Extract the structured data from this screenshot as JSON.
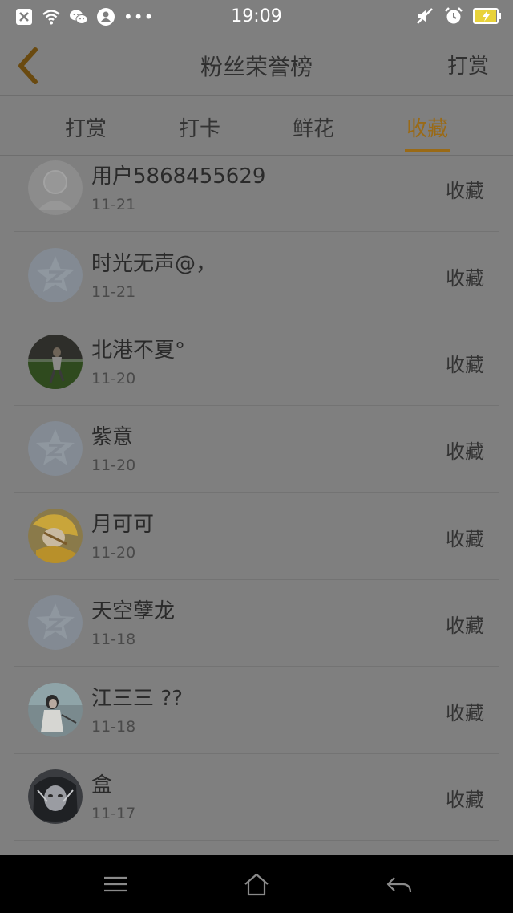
{
  "status_bar": {
    "time": "19:09",
    "dots": "•••",
    "left_icons": [
      "close-box-icon",
      "wifi-icon",
      "wechat-icon",
      "notification-icon"
    ],
    "right_icons": [
      "mute-icon",
      "alarm-icon",
      "battery-charging-icon"
    ]
  },
  "header": {
    "title": "粉丝荣誉榜",
    "action_label": "打赏",
    "accent_color": "#9a6a16"
  },
  "tabs": [
    {
      "label": "打赏",
      "active": false
    },
    {
      "label": "打卡",
      "active": false
    },
    {
      "label": "鲜花",
      "active": false
    },
    {
      "label": "收藏",
      "active": true
    }
  ],
  "list": [
    {
      "name": "用户5868455629",
      "date": "11-21",
      "action": "收藏",
      "avatar": "default-user"
    },
    {
      "name": "时光无声@，",
      "date": "11-21",
      "action": "收藏",
      "avatar": "qzone-star"
    },
    {
      "name": "北港不夏°",
      "date": "11-20",
      "action": "收藏",
      "avatar": "photo-grass"
    },
    {
      "name": "紫意",
      "date": "11-20",
      "action": "收藏",
      "avatar": "qzone-star"
    },
    {
      "name": "月可可",
      "date": "11-20",
      "action": "收藏",
      "avatar": "photo-anime"
    },
    {
      "name": "天空孽龙",
      "date": "11-18",
      "action": "收藏",
      "avatar": "qzone-star"
    },
    {
      "name": "江三三 ??",
      "date": "11-18",
      "action": "收藏",
      "avatar": "photo-girl"
    },
    {
      "name": "盒",
      "date": "11-17",
      "action": "收藏",
      "avatar": "photo-dark"
    }
  ],
  "nav": [
    "menu-icon",
    "home-icon",
    "back-icon"
  ]
}
